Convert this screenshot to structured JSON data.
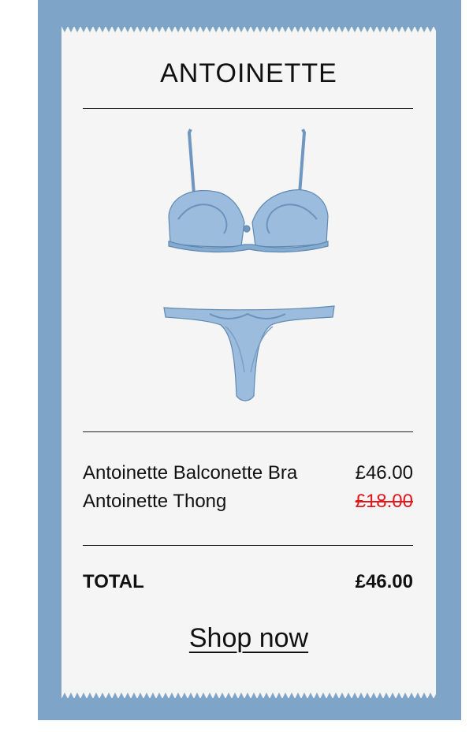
{
  "receipt": {
    "title": "ANTOINETTE",
    "product_image": "antoinette-lingerie-set",
    "items": [
      {
        "name": "Antoinette Balconette Bra",
        "price": "£46.00",
        "struck": false
      },
      {
        "name": "Antoinette Thong",
        "price": "£18.00",
        "struck": true
      }
    ],
    "total_label": "TOTAL",
    "total_value": "£46.00",
    "cta_label": "Shop now"
  },
  "colors": {
    "frame": "#7ea4c8",
    "paper": "#f5f5f6",
    "product_blue": "#8fb3d6",
    "strike_red": "#e0191f"
  }
}
